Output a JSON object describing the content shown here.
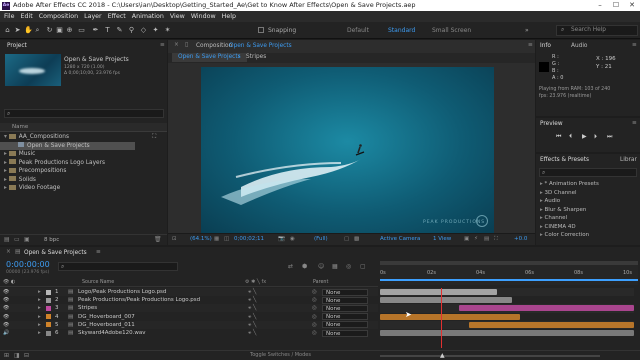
{
  "window": {
    "title": "Adobe After Effects CC 2018 - C:\\Users\\ian\\Desktop\\Getting_Started_Ae\\Get to Know After Effects\\Open & Save Projects.aep",
    "logo": "Ae"
  },
  "menu": [
    "File",
    "Edit",
    "Composition",
    "Layer",
    "Effect",
    "Animation",
    "View",
    "Window",
    "Help"
  ],
  "toolbar": {
    "snapping": "Snapping",
    "workspaces": [
      "Default",
      "Standard",
      "Small Screen"
    ],
    "active_workspace": "Standard",
    "search_placeholder": "Search Help"
  },
  "project": {
    "panel_title": "Project",
    "preview_name": "Open & Save Projects",
    "preview_meta1": "1280 x 720 (1.00)",
    "preview_meta2": "Δ 0;00;10;00, 23.976 fps",
    "name_header": "Name",
    "items": [
      {
        "name": "AA_Compositions",
        "type": "folder",
        "indent": 0
      },
      {
        "name": "Open & Save Projects",
        "type": "comp",
        "indent": 1
      },
      {
        "name": "Music",
        "type": "folder",
        "indent": 0
      },
      {
        "name": "Peak Productions Logo Layers",
        "type": "folder",
        "indent": 0
      },
      {
        "name": "Precompositions",
        "type": "folder",
        "indent": 0
      },
      {
        "name": "Solids",
        "type": "folder",
        "indent": 0
      },
      {
        "name": "Video Footage",
        "type": "folder",
        "indent": 0
      }
    ],
    "bpc": "8 bpc"
  },
  "composition": {
    "panel_title": "Composition",
    "comp_name": "Open & Save Projects",
    "tabs": [
      "Open & Save Projects",
      "Stripes"
    ],
    "watermark": "PEAK PRODUCTIONS",
    "zoom": "(64.1%)",
    "timecode": "0;00;02;11",
    "resolution": "(Full)",
    "camera": "Active Camera",
    "views": "1 View",
    "exposure": "+0.0"
  },
  "info": {
    "tabs": [
      "Info",
      "Audio"
    ],
    "rgba": [
      "R :",
      "G :",
      "B :",
      "A : 0"
    ],
    "x": "X : 196",
    "y": "Y : 21",
    "playing1": "Playing from RAM: 103 of 240",
    "playing2": "fps: 23.976 (realtime)"
  },
  "preview": {
    "title": "Preview"
  },
  "effects": {
    "tabs": [
      "Effects & Presets",
      "Librar"
    ],
    "items": [
      "* Animation Presets",
      "3D Channel",
      "Audio",
      "Blur & Sharpen",
      "Channel",
      "CINEMA 4D",
      "Color Correction"
    ]
  },
  "timeline": {
    "tab": "Open & Save Projects",
    "timecode": "0:00:00:00",
    "frames": "00000 (23.976 fps)",
    "source_header": "Source Name",
    "parent_header": "Parent",
    "ruler": [
      "0s",
      "02s",
      "04s",
      "06s",
      "08s",
      "10s"
    ],
    "playhead_fraction": 0.24,
    "layers": [
      {
        "num": "1",
        "name": "Logo/Peak Productions Logo.psd",
        "parent": "None",
        "color": "#b8b8b8",
        "start": 0.0,
        "end": 0.46
      },
      {
        "num": "2",
        "name": "Peak Productions/Peak Productions Logo.psd",
        "parent": "None",
        "color": "#9a9a9a",
        "start": 0.0,
        "end": 0.52
      },
      {
        "num": "3",
        "name": "Stripes",
        "parent": "None",
        "color": "#c04aa0",
        "start": 0.31,
        "end": 1.0
      },
      {
        "num": "4",
        "name": "DG_Hoverboard_007",
        "parent": "None",
        "color": "#d0832a",
        "start": 0.0,
        "end": 0.55
      },
      {
        "num": "5",
        "name": "DG_Hoverboard_011",
        "parent": "None",
        "color": "#d0832a",
        "start": 0.35,
        "end": 1.0
      },
      {
        "num": "6",
        "name": "Skyward4Adobe120.wav",
        "parent": "None",
        "color": "#888888",
        "start": 0.0,
        "end": 1.0
      }
    ],
    "footer": "Toggle Switches / Modes"
  }
}
